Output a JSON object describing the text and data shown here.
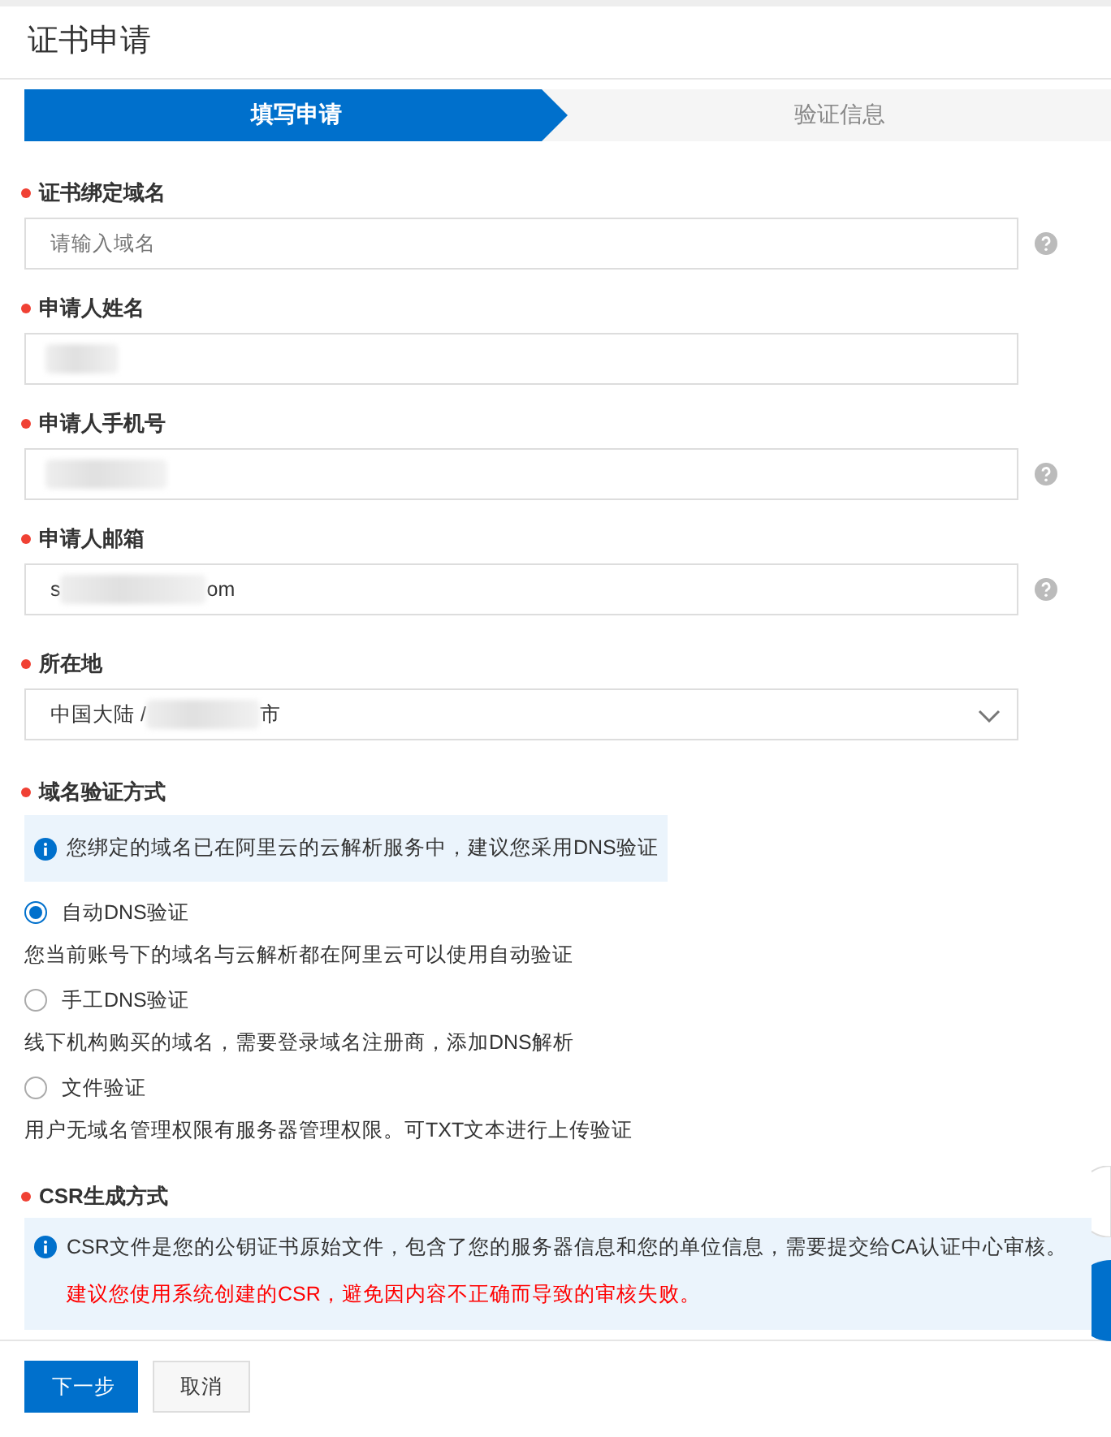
{
  "title": "证书申请",
  "steps": [
    {
      "label": "填写申请",
      "selected": true
    },
    {
      "label": "验证信息",
      "selected": false
    }
  ],
  "fields": [
    {
      "kind": "input",
      "label": "证书绑定域名",
      "required": true,
      "placeholder": "请输入域名",
      "help": true
    },
    {
      "kind": "input",
      "label": "申请人姓名",
      "required": true,
      "redacted": true,
      "help": false
    },
    {
      "kind": "input",
      "label": "申请人手机号",
      "required": true,
      "redacted": true,
      "help": true
    },
    {
      "kind": "input",
      "label": "申请人邮箱",
      "required": true,
      "value_start": "s",
      "value_end": "om",
      "redacted": true,
      "help": true
    },
    {
      "kind": "select",
      "label": "所在地",
      "required": true,
      "value_start": "中国大陆 /",
      "value_end": "市",
      "redacted": true,
      "help": false
    }
  ],
  "verification": {
    "label": "域名验证方式",
    "required": true,
    "notice": "您绑定的域名已在阿里云的云解析服务中，建议您采用DNS验证",
    "options": [
      {
        "label": "自动DNS验证",
        "description": "您当前账号下的域名与云解析都在阿里云可以使用自动验证",
        "selected": true
      },
      {
        "label": "手工DNS验证",
        "description": "线下机构购买的域名，需要登录域名注册商，添加DNS解析",
        "selected": false
      },
      {
        "label": "文件验证",
        "description": "用户无域名管理权限有服务器管理权限。可TXT文本进行上传验证",
        "selected": false
      }
    ]
  },
  "csr": {
    "label": "CSR生成方式",
    "required": true,
    "notice": "CSR文件是您的公钥证书原始文件，包含了您的服务器信息和您的单位信息，需要提交给CA认证中心审核。",
    "warning": "建议您使用系统创建的CSR，避免因内容不正确而导致的审核失败。"
  },
  "buttons": [
    {
      "label": "下一步",
      "kind": "primary"
    },
    {
      "label": "取消",
      "kind": "default"
    }
  ]
}
